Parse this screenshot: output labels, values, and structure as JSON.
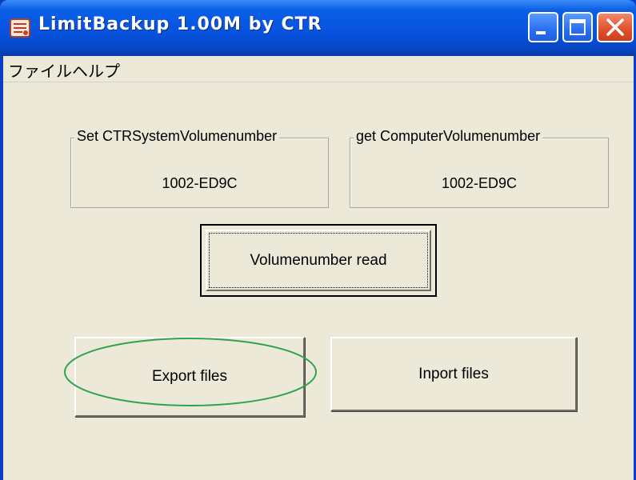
{
  "window": {
    "title": "LimitBackup 1.00M by CTR",
    "title_buttons": [
      "minimize",
      "maximize",
      "close"
    ]
  },
  "menu": {
    "items": [
      {
        "label": "ファイル"
      },
      {
        "label": "ヘルプ"
      }
    ]
  },
  "groups": {
    "ctr_system": {
      "label": "Set CTRSystemVolumenumber",
      "value": "1002-ED9C"
    },
    "computer": {
      "label": "get ComputerVolumenumber",
      "value": "1002-ED9C"
    }
  },
  "buttons": {
    "volumenumber_read": "Volumenumber read",
    "export": "Export files",
    "import": "Inport files"
  },
  "colors": {
    "titlebar": "#0753e0",
    "dialog_bg": "#ece9d8",
    "annotation": "#2ea44f"
  },
  "icons": {
    "app": "app-icon",
    "minimize": "minimize-icon",
    "maximize": "maximize-icon",
    "close": "close-icon"
  }
}
